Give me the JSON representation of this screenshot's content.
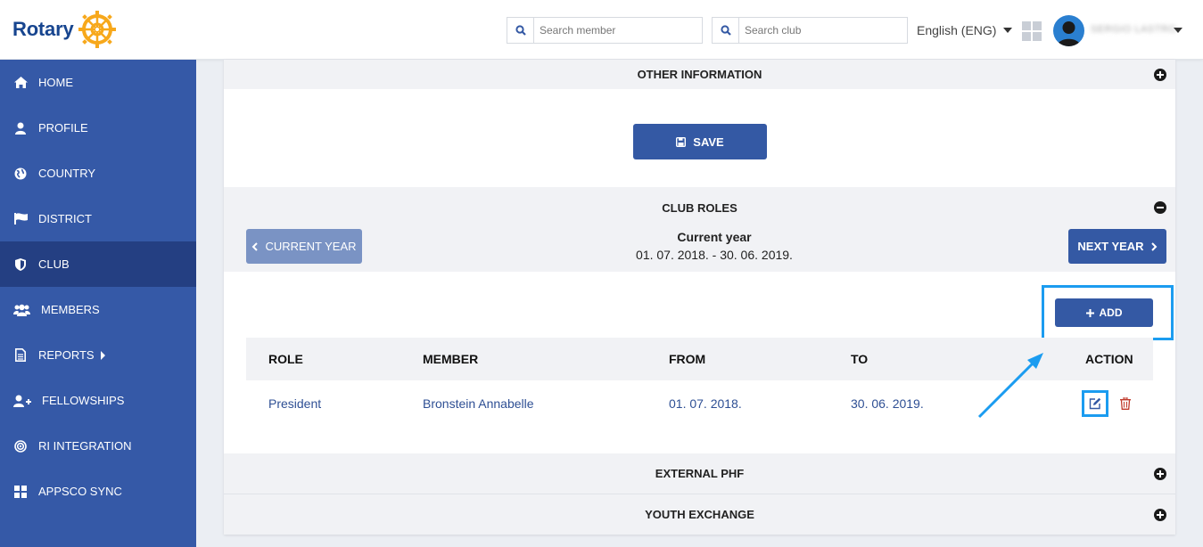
{
  "header": {
    "logo_text": "Rotary",
    "search_member_placeholder": "Search member",
    "search_club_placeholder": "Search club",
    "language": "English (ENG)",
    "user_name": "SERGIO LASTRO"
  },
  "sidebar": {
    "items": [
      {
        "label": "HOME",
        "icon": "home-icon"
      },
      {
        "label": "PROFILE",
        "icon": "user-icon"
      },
      {
        "label": "COUNTRY",
        "icon": "globe-icon"
      },
      {
        "label": "DISTRICT",
        "icon": "flag-icon"
      },
      {
        "label": "CLUB",
        "icon": "shield-icon",
        "active": true
      },
      {
        "label": "MEMBERS",
        "icon": "users-icon"
      },
      {
        "label": "REPORTS",
        "icon": "document-icon"
      },
      {
        "label": "FELLOWSHIPS",
        "icon": "user-plus-icon"
      },
      {
        "label": "RI INTEGRATION",
        "icon": "target-icon"
      },
      {
        "label": "APPSCO SYNC",
        "icon": "grid-icon"
      }
    ]
  },
  "sections": {
    "other_information": "OTHER INFORMATION",
    "club_roles": "CLUB ROLES",
    "external_phf": "EXTERNAL PHF",
    "youth_exchange": "YOUTH EXCHANGE"
  },
  "buttons": {
    "save": "SAVE",
    "current_year": "CURRENT YEAR",
    "next_year": "NEXT YEAR",
    "add": "ADD"
  },
  "year": {
    "title": "Current year",
    "range": "01. 07. 2018. - 30. 06. 2019."
  },
  "roles_table": {
    "columns": [
      "ROLE",
      "MEMBER",
      "FROM",
      "TO",
      "ACTION"
    ],
    "rows": [
      {
        "role": "President",
        "member": "Bronstein Annabelle",
        "from": "01. 07. 2018.",
        "to": "30. 06. 2019."
      }
    ]
  },
  "colors": {
    "primary": "#3459a4",
    "sidebar": "#3559a7",
    "sidebar_active": "#243f82",
    "highlight": "#1b9cf0",
    "delete": "#c0392b"
  }
}
